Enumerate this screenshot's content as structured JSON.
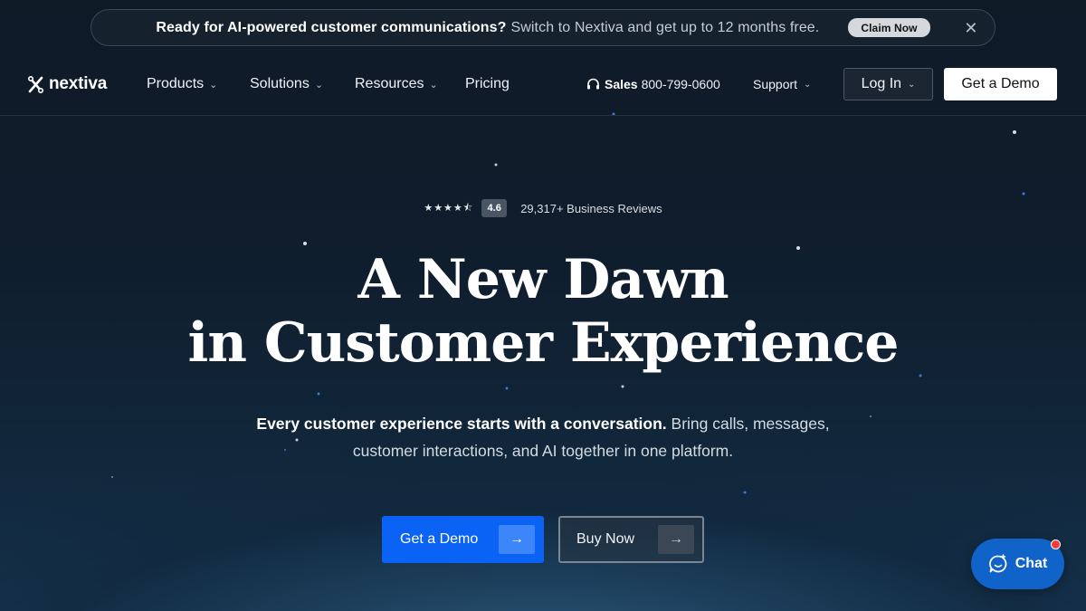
{
  "promo": {
    "headline": "Ready for AI-powered customer communications?",
    "message": "Switch to Nextiva and get up to 12 months free.",
    "cta_label": "Claim Now",
    "close_icon": "close-icon"
  },
  "nav": {
    "logo_text": "nextiva",
    "items": [
      {
        "label": "Products",
        "has_dropdown": true
      },
      {
        "label": "Solutions",
        "has_dropdown": true
      },
      {
        "label": "Resources",
        "has_dropdown": true
      },
      {
        "label": "Pricing",
        "has_dropdown": false
      }
    ],
    "sales_label": "Sales",
    "sales_phone": "800-799-0600",
    "support_label": "Support",
    "login_label": "Log In",
    "demo_label": "Get a Demo"
  },
  "hero": {
    "rating": "4.6",
    "rating_stars": 4.5,
    "review_count": "29,317+ Business Reviews",
    "headline_line1": "A New Dawn",
    "headline_line2": "in Customer Experience",
    "sub_strong": "Every customer experience starts with a conversation.",
    "sub_rest": "Bring calls, messages, customer interactions, and AI together in one platform.",
    "primary_cta": "Get a Demo",
    "secondary_cta": "Buy Now"
  },
  "chat": {
    "label": "Chat"
  },
  "colors": {
    "primary_blue": "#0b63f6",
    "chat_blue": "#0f63c9",
    "notification_red": "#f03b3b"
  }
}
